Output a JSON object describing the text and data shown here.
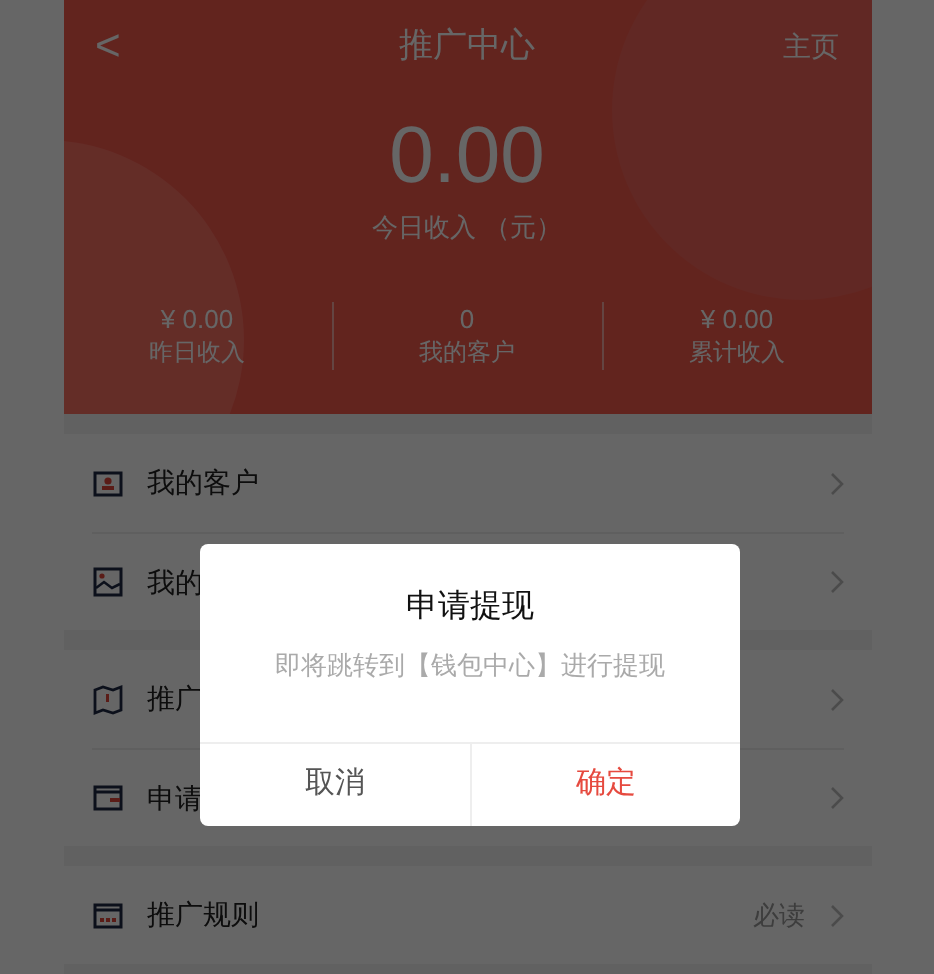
{
  "header": {
    "title": "推广中心",
    "back": "<",
    "home_link": "主页",
    "today_amount": "0.00",
    "today_label": "今日收入 （元）",
    "stats": [
      {
        "value": "¥ 0.00",
        "label": "昨日收入"
      },
      {
        "value": "0",
        "label": "我的客户"
      },
      {
        "value": "¥ 0.00",
        "label": "累计收入"
      }
    ]
  },
  "menu_groups": [
    {
      "items": [
        {
          "label": "我的客户"
        },
        {
          "label": "我的"
        }
      ]
    },
    {
      "items": [
        {
          "label": "推广"
        },
        {
          "label": "申请"
        }
      ]
    },
    {
      "items": [
        {
          "label": "推广规则",
          "note": "必读"
        }
      ]
    }
  ],
  "dialog": {
    "title": "申请提现",
    "message": "即将跳转到【钱包中心】进行提现",
    "buttons": [
      {
        "label": "取消",
        "kind": "cancel"
      },
      {
        "label": "确定",
        "kind": "confirm"
      }
    ]
  }
}
